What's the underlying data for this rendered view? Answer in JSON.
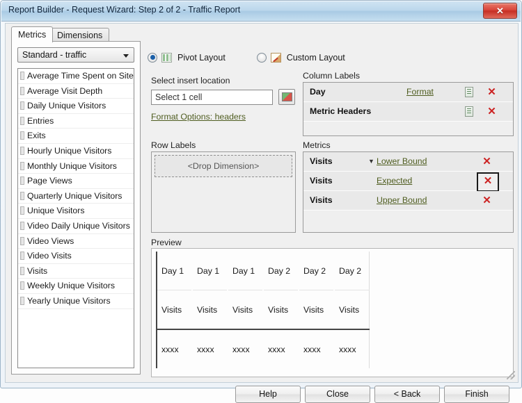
{
  "window": {
    "title": "Report Builder - Request Wizard: Step 2 of 2 - Traffic Report",
    "close_label": "✕"
  },
  "tabs": [
    {
      "label": "Metrics",
      "active": true
    },
    {
      "label": "Dimensions",
      "active": false
    }
  ],
  "left_panel": {
    "combo_value": "Standard - traffic",
    "items": [
      "Average Time Spent on Site",
      "Average Visit Depth",
      "Daily Unique Visitors",
      "Entries",
      "Exits",
      "Hourly Unique Visitors",
      "Monthly Unique Visitors",
      "Page Views",
      "Quarterly Unique Visitors",
      "Unique Visitors",
      "Video Daily Unique Visitors",
      "Video Views",
      "Video Visits",
      "Visits",
      "Weekly Unique Visitors",
      "Yearly Unique Visitors"
    ]
  },
  "layout_options": {
    "pivot_label": "Pivot Layout",
    "custom_label": "Custom Layout",
    "selected": "Pivot Layout"
  },
  "insert_location": {
    "label": "Select insert location",
    "value": "Select 1 cell",
    "placeholder": "Select 1 cell",
    "format_options_link": "Format Options: headers"
  },
  "row_labels": {
    "label": "Row Labels",
    "dropzone_text": "<Drop Dimension>"
  },
  "column_labels": {
    "label": "Column Labels",
    "rows": [
      {
        "name": "Day",
        "link": "Format",
        "has_prop_icon": true,
        "remove": "✕"
      },
      {
        "name": "Metric Headers",
        "link": "",
        "has_prop_icon": true,
        "remove": "✕"
      }
    ]
  },
  "metrics_panel": {
    "label": "Metrics",
    "rows": [
      {
        "name": "Visits",
        "link": "Lower Bound",
        "sort": "▼",
        "remove": "✕",
        "focused": false
      },
      {
        "name": "Visits",
        "link": "Expected",
        "sort": "",
        "remove": "✕",
        "focused": true
      },
      {
        "name": "Visits",
        "link": "Upper Bound",
        "sort": "",
        "remove": "✕",
        "focused": false
      }
    ]
  },
  "preview": {
    "label": "Preview",
    "header_row": [
      "Day 1",
      "Day 1",
      "Day 1",
      "Day 2",
      "Day 2",
      "Day 2"
    ],
    "metric_row": [
      "Visits",
      "Visits",
      "Visits",
      "Visits",
      "Visits",
      "Visits"
    ],
    "data_row": [
      "xxxx",
      "xxxx",
      "xxxx",
      "xxxx",
      "xxxx",
      "xxxx"
    ]
  },
  "footer_buttons": [
    {
      "label": "Help"
    },
    {
      "label": "Close"
    },
    {
      "label": "< Back"
    },
    {
      "label": "Finish"
    }
  ],
  "colors": {
    "link": "#4f5d20",
    "remove": "#cc2222",
    "radio_accent": "#1b5fa8",
    "titlebar": "#bcd7ec",
    "close_button": "#d8453a"
  }
}
